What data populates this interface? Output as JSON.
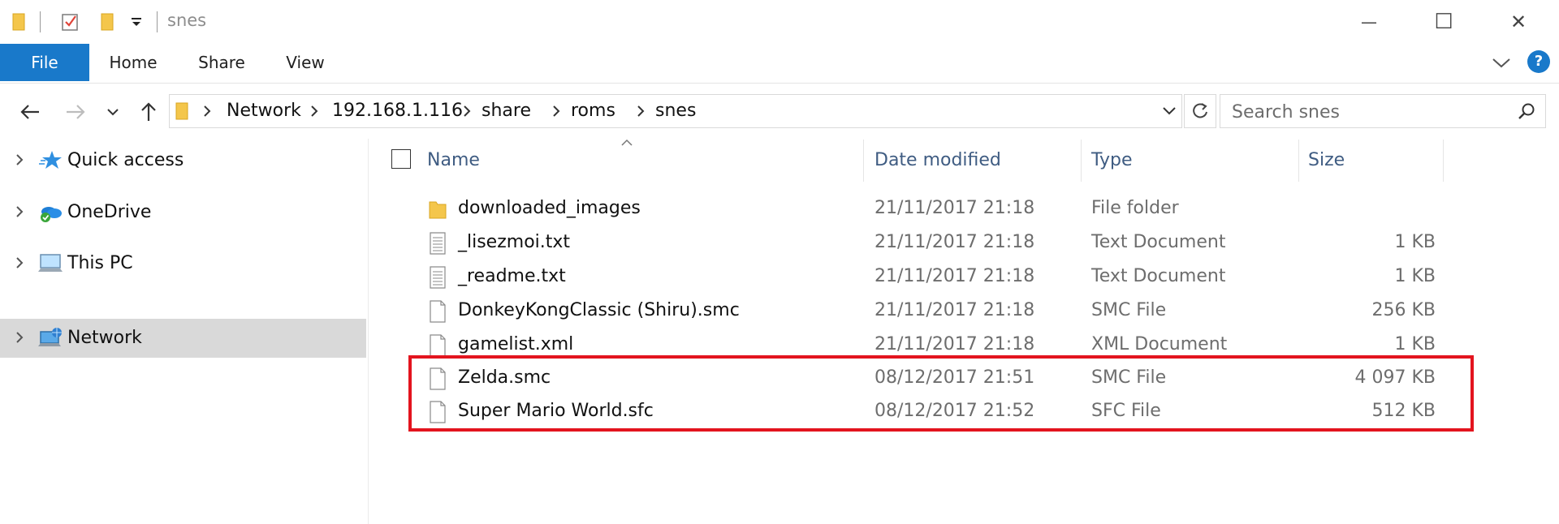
{
  "window": {
    "title": "snes",
    "minimize_symbol": "—",
    "maximize_symbol": "☐",
    "close_symbol": "✕"
  },
  "ribbon": {
    "tabs": [
      {
        "label": "File"
      },
      {
        "label": "Home"
      },
      {
        "label": "Share"
      },
      {
        "label": "View"
      }
    ],
    "help_symbol": "?"
  },
  "address": {
    "breadcrumbs": [
      "Network",
      "192.168.1.116",
      "share",
      "roms",
      "snes"
    ]
  },
  "search": {
    "placeholder": "Search snes"
  },
  "navpane": {
    "items": [
      {
        "label": "Quick access",
        "icon": "star-icon"
      },
      {
        "label": "OneDrive",
        "icon": "onedrive-icon"
      },
      {
        "label": "This PC",
        "icon": "this-pc-icon"
      },
      {
        "label": "Network",
        "icon": "network-icon",
        "selected": true
      }
    ]
  },
  "columns": {
    "name": "Name",
    "date": "Date modified",
    "type": "Type",
    "size": "Size"
  },
  "files": [
    {
      "name": "downloaded_images",
      "date": "21/11/2017 21:18",
      "type": "File folder",
      "size": "",
      "icon": "folder-icon"
    },
    {
      "name": "_lisezmoi.txt",
      "date": "21/11/2017 21:18",
      "type": "Text Document",
      "size": "1 KB",
      "icon": "text-document-icon"
    },
    {
      "name": "_readme.txt",
      "date": "21/11/2017 21:18",
      "type": "Text Document",
      "size": "1 KB",
      "icon": "text-document-icon"
    },
    {
      "name": "DonkeyKongClassic (Shiru).smc",
      "date": "21/11/2017 21:18",
      "type": "SMC File",
      "size": "256 KB",
      "icon": "file-icon"
    },
    {
      "name": "gamelist.xml",
      "date": "21/11/2017 21:18",
      "type": "XML Document",
      "size": "1 KB",
      "icon": "file-icon"
    },
    {
      "name": "Zelda.smc",
      "date": "08/12/2017 21:51",
      "type": "SMC File",
      "size": "4 097 KB",
      "icon": "file-icon"
    },
    {
      "name": "Super Mario World.sfc",
      "date": "08/12/2017 21:52",
      "type": "SFC File",
      "size": "512 KB",
      "icon": "file-icon"
    }
  ],
  "colors": {
    "file_tab": "#1979ca",
    "highlight_border": "#e3141e",
    "selected_nav": "#d9d9d9",
    "column_header_text": "#3f5c82"
  }
}
